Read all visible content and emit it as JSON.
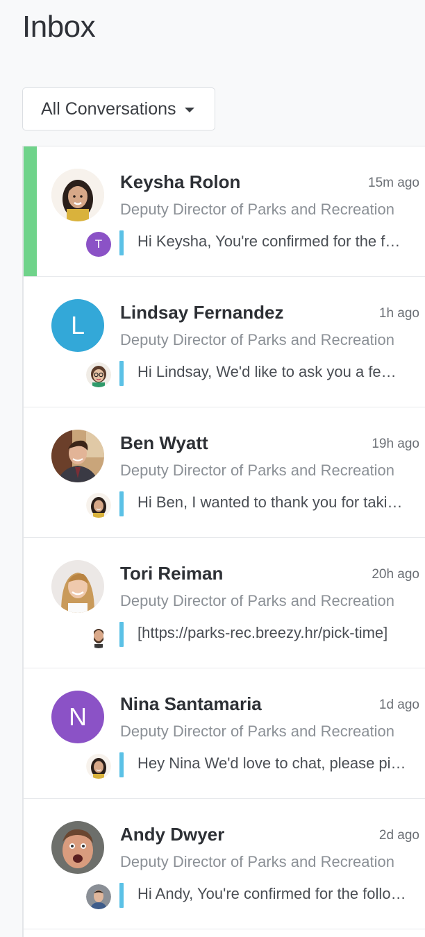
{
  "page": {
    "title": "Inbox"
  },
  "filter": {
    "label": "All Conversations"
  },
  "colors": {
    "accent_unread": "#6fd38a",
    "quote_bar": "#5bc1e6",
    "lindsay_avatar": "#33a8d8",
    "nina_avatar": "#8b52c6",
    "t_avatar": "#8b52c6"
  },
  "conversations": [
    {
      "name": "Keysha Rolon",
      "time": "15m ago",
      "subtitle": "Deputy Director of Parks and Recreation",
      "preview": "Hi Keysha, You're confirmed for the following time",
      "sender_initial": "T",
      "unread": true
    },
    {
      "name": "Lindsay Fernandez",
      "time": "1h ago",
      "subtitle": "Deputy Director of Parks and Recreation",
      "preview": "Hi Lindsay, We'd like to ask you a few questions",
      "avatar_initial": "L"
    },
    {
      "name": "Ben Wyatt",
      "time": "19h ago",
      "subtitle": "Deputy Director of Parks and Recreation",
      "preview": "Hi Ben, I wanted to thank you for taking the time"
    },
    {
      "name": "Tori Reiman",
      "time": "20h ago",
      "subtitle": "Deputy Director of Parks and Recreation",
      "preview": "[https://parks-rec.breezy.hr/pick-time]"
    },
    {
      "name": "Nina Santamaria",
      "time": "1d ago",
      "subtitle": "Deputy Director of Parks and Recreation",
      "preview": "Hey Nina We'd love to chat, please pick a time",
      "avatar_initial": "N"
    },
    {
      "name": "Andy Dwyer",
      "time": "2d ago",
      "subtitle": "Deputy Director of Parks and Recreation",
      "preview": "Hi Andy, You're confirmed for the following time"
    }
  ]
}
